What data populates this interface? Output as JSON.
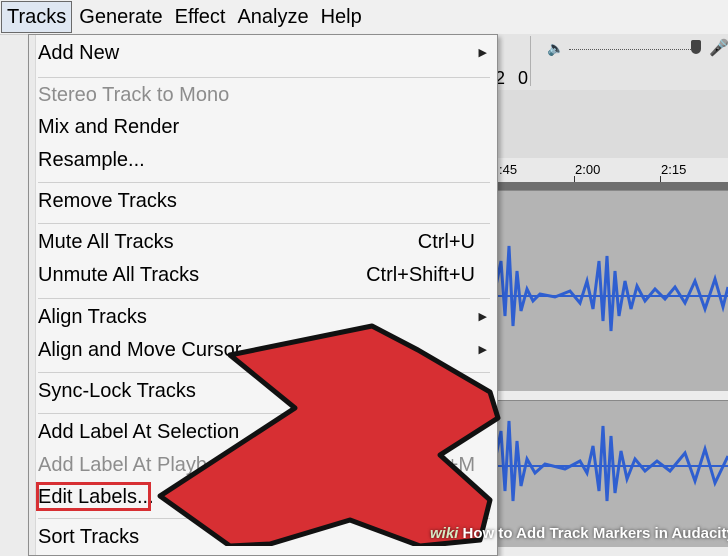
{
  "menubar": {
    "items": [
      {
        "label": "Tracks"
      },
      {
        "label": "Generate"
      },
      {
        "label": "Effect"
      },
      {
        "label": "Analyze"
      },
      {
        "label": "Help"
      }
    ]
  },
  "background": {
    "partial_digits": "2 0",
    "ruler_ticks": [
      ":45",
      "2:00",
      "2:15"
    ],
    "volume_icon": "speaker-icon",
    "mic_icon": "microphone-icon"
  },
  "menu": {
    "items": [
      {
        "label": "Add New",
        "shortcut": "",
        "submenu": true,
        "disabled": false
      },
      {
        "label": "Stereo Track to Mono",
        "shortcut": "",
        "submenu": false,
        "disabled": true
      },
      {
        "label": "Mix and Render",
        "shortcut": "",
        "submenu": false,
        "disabled": false
      },
      {
        "label": "Resample...",
        "shortcut": "",
        "submenu": false,
        "disabled": false
      },
      {
        "label": "Remove Tracks",
        "shortcut": "",
        "submenu": false,
        "disabled": false
      },
      {
        "label": "Mute All Tracks",
        "shortcut": "Ctrl+U",
        "submenu": false,
        "disabled": false
      },
      {
        "label": "Unmute All Tracks",
        "shortcut": "Ctrl+Shift+U",
        "submenu": false,
        "disabled": false
      },
      {
        "label": "Align Tracks",
        "shortcut": "",
        "submenu": true,
        "disabled": false
      },
      {
        "label": "Align and Move Cursor",
        "shortcut": "",
        "submenu": true,
        "disabled": false
      },
      {
        "label": "Sync-Lock Tracks",
        "shortcut": "",
        "submenu": false,
        "disabled": false
      },
      {
        "label": "Add Label At Selection",
        "shortcut": "",
        "submenu": false,
        "disabled": false
      },
      {
        "label": "Add Label At Playback Position",
        "shortcut": "Ctrl+M",
        "submenu": false,
        "disabled": true
      },
      {
        "label": "Edit Labels...",
        "shortcut": "",
        "submenu": false,
        "disabled": false
      },
      {
        "label": "Sort Tracks",
        "shortcut": "",
        "submenu": false,
        "disabled": false
      }
    ]
  },
  "annotation": {
    "color": "#d72f33"
  },
  "watermark": {
    "prefix": "wiki",
    "text": "How to Add Track Markers in Audacity"
  },
  "colors": {
    "waveform": "#2f5fd0",
    "track_bg": "#b4b4b4",
    "arrow_fill": "#d72f33"
  }
}
